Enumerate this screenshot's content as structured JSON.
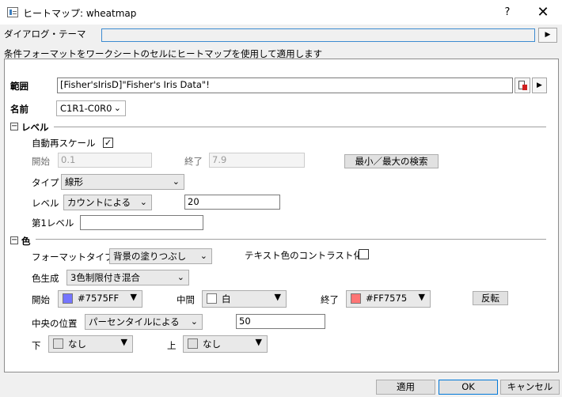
{
  "window": {
    "title": "ヒートマップ: wheatmap",
    "help_label": "?",
    "close_label": "✕"
  },
  "theme": {
    "label": "ダイアログ・テーマ",
    "value": ""
  },
  "description": "条件フォーマットをワークシートのセルにヒートマップを使用して適用します",
  "range": {
    "label": "範囲",
    "value": "[Fisher'sIrisD]\"Fisher's Iris Data\"!"
  },
  "name": {
    "label": "名前",
    "value": "C1R1-C0R0"
  },
  "levels": {
    "section_label": "レベル",
    "toggle_symbol": "−",
    "auto_rescale_label": "自動再スケール",
    "auto_rescale_checked": true,
    "start_label": "開始",
    "start_value": "0.1",
    "end_label": "終了",
    "end_value": "7.9",
    "find_minmax_label": "最小／最大の検索",
    "type_label": "タイプ",
    "type_value": "線形",
    "level_label": "レベル",
    "level_mode_value": "カウントによる",
    "level_count_value": "20",
    "first_level_label": "第1レベル",
    "first_level_value": ""
  },
  "color": {
    "section_label": "色",
    "toggle_symbol": "−",
    "format_type_label": "フォーマットタイプ",
    "format_type_value": "背景の塗りつぶし",
    "text_contrast_label": "テキスト色のコントラスト化",
    "text_contrast_checked": false,
    "generation_label": "色生成",
    "generation_value": "3色制限付き混合",
    "start_label": "開始",
    "start_color": "#7575FF",
    "start_color_text": "#7575FF",
    "mid_label": "中間",
    "mid_color": "#FFFFFF",
    "mid_color_text": "白",
    "end_label": "終了",
    "end_color": "#FF7575",
    "end_color_text": "#FF7575",
    "reverse_label": "反転",
    "center_label": "中央の位置",
    "center_mode_value": "パーセンタイルによる",
    "center_value": "50",
    "below_label": "下",
    "below_color": "#E0E0E0",
    "below_value": "なし",
    "above_label": "上",
    "above_color": "#E0E0E0",
    "above_value": "なし"
  },
  "footer": {
    "apply_label": "適用",
    "ok_label": "OK",
    "cancel_label": "キャンセル"
  }
}
